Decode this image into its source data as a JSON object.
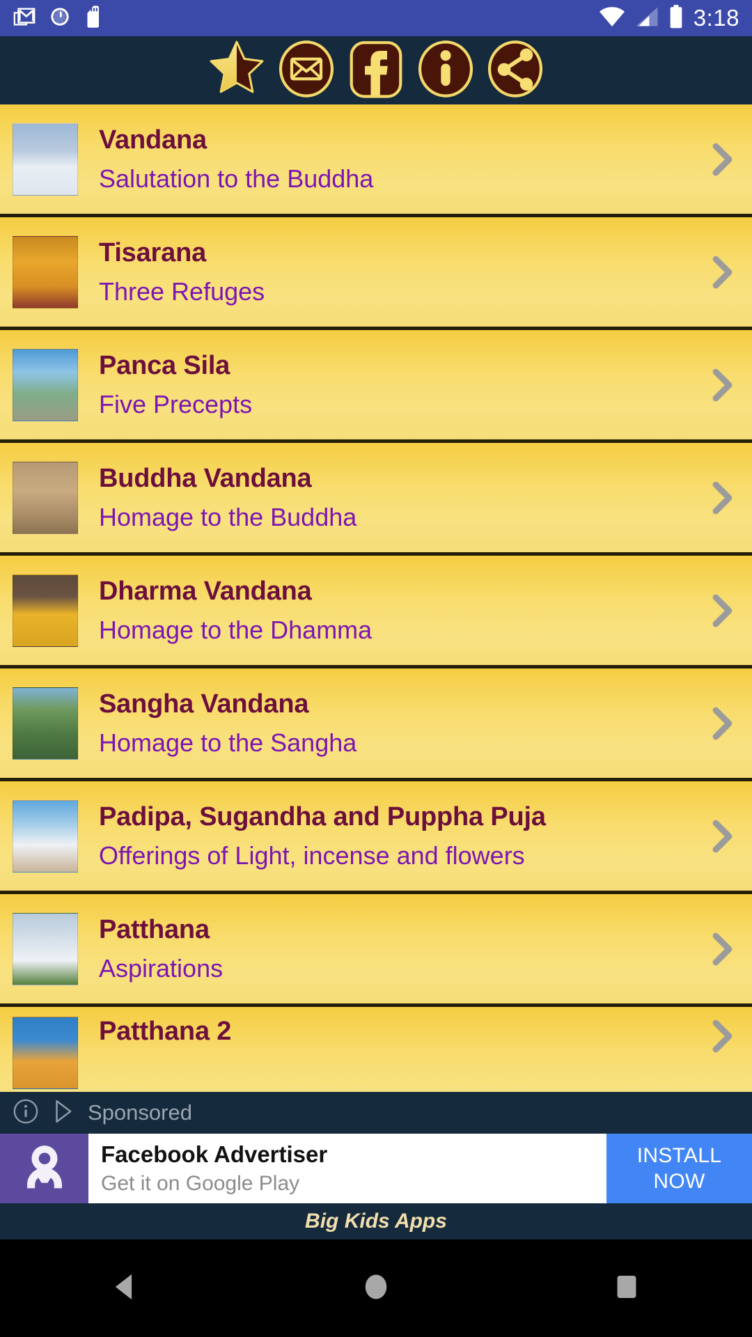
{
  "status_bar": {
    "time": "3:18",
    "left_icons": [
      "gmail-icon",
      "clock-icon",
      "sd-card-icon"
    ],
    "right_icons": [
      "wifi-icon",
      "cell-signal-icon",
      "battery-icon"
    ],
    "background_color": "#3b4aa8"
  },
  "toolbar": {
    "background_color": "#152a3c",
    "accent_color": "#f6de72",
    "icon_fill_color": "#4a1509",
    "buttons": [
      {
        "name": "rate-star-button",
        "icon": "star-half-icon",
        "label": "Rate"
      },
      {
        "name": "email-button",
        "icon": "mail-icon",
        "label": "Email"
      },
      {
        "name": "facebook-button",
        "icon": "facebook-icon",
        "label": "Facebook"
      },
      {
        "name": "info-button",
        "icon": "info-icon",
        "label": "Info"
      },
      {
        "name": "share-button",
        "icon": "share-icon",
        "label": "Share"
      }
    ]
  },
  "list": {
    "row_gradient_top": "#f5cd42",
    "row_gradient_bottom": "#f6dd79",
    "title_color": "#6d0f3c",
    "subtitle_color": "#7d15b2",
    "separator_color": "#241d07",
    "chevron_icon": "chevron-right-icon",
    "items": [
      {
        "title": "Vandana",
        "subtitle": "Salutation to the Buddha",
        "thumb": "white-buddha-statue"
      },
      {
        "title": "Tisarana",
        "subtitle": "Three Refuges",
        "thumb": "golden-buddha-statue"
      },
      {
        "title": "Panca Sila",
        "subtitle": "Five Precepts",
        "thumb": "stone-buddhas-lake"
      },
      {
        "title": "Buddha Vandana",
        "subtitle": "Homage to the Buddha",
        "thumb": "stone-carved-buddha"
      },
      {
        "title": "Dharma Vandana",
        "subtitle": "Homage to the Dhamma",
        "thumb": "gold-standing-buddha"
      },
      {
        "title": "Sangha Vandana",
        "subtitle": "Homage to the Sangha",
        "thumb": "hilltop-temple"
      },
      {
        "title": "Padipa, Sugandha and Puppha Puja",
        "subtitle": "Offerings of Light, incense and flowers",
        "thumb": "white-stupa"
      },
      {
        "title": "Patthana",
        "subtitle": "Aspirations",
        "thumb": "white-dagoba"
      },
      {
        "title": "Patthana 2",
        "subtitle": "",
        "thumb": "orange-robe-buddha"
      }
    ]
  },
  "ad": {
    "sponsored_label": "Sponsored",
    "info_icon": "info-circle-icon",
    "play_icon": "play-triangle-icon",
    "avatar_icon": "person-avatar-icon",
    "advertiser": "Facebook Advertiser",
    "tagline": "Get it on Google Play",
    "cta_line1": "INSTALL",
    "cta_line2": "NOW",
    "cta_color": "#4285f4",
    "avatar_bg": "#5b4a9e"
  },
  "brand_bar": {
    "text": "Big Kids Apps",
    "color": "#f3dfae"
  },
  "nav_bar": {
    "buttons": [
      {
        "name": "nav-back-button",
        "icon": "back-triangle-icon"
      },
      {
        "name": "nav-home-button",
        "icon": "home-circle-icon"
      },
      {
        "name": "nav-recents-button",
        "icon": "recents-square-icon"
      }
    ]
  }
}
